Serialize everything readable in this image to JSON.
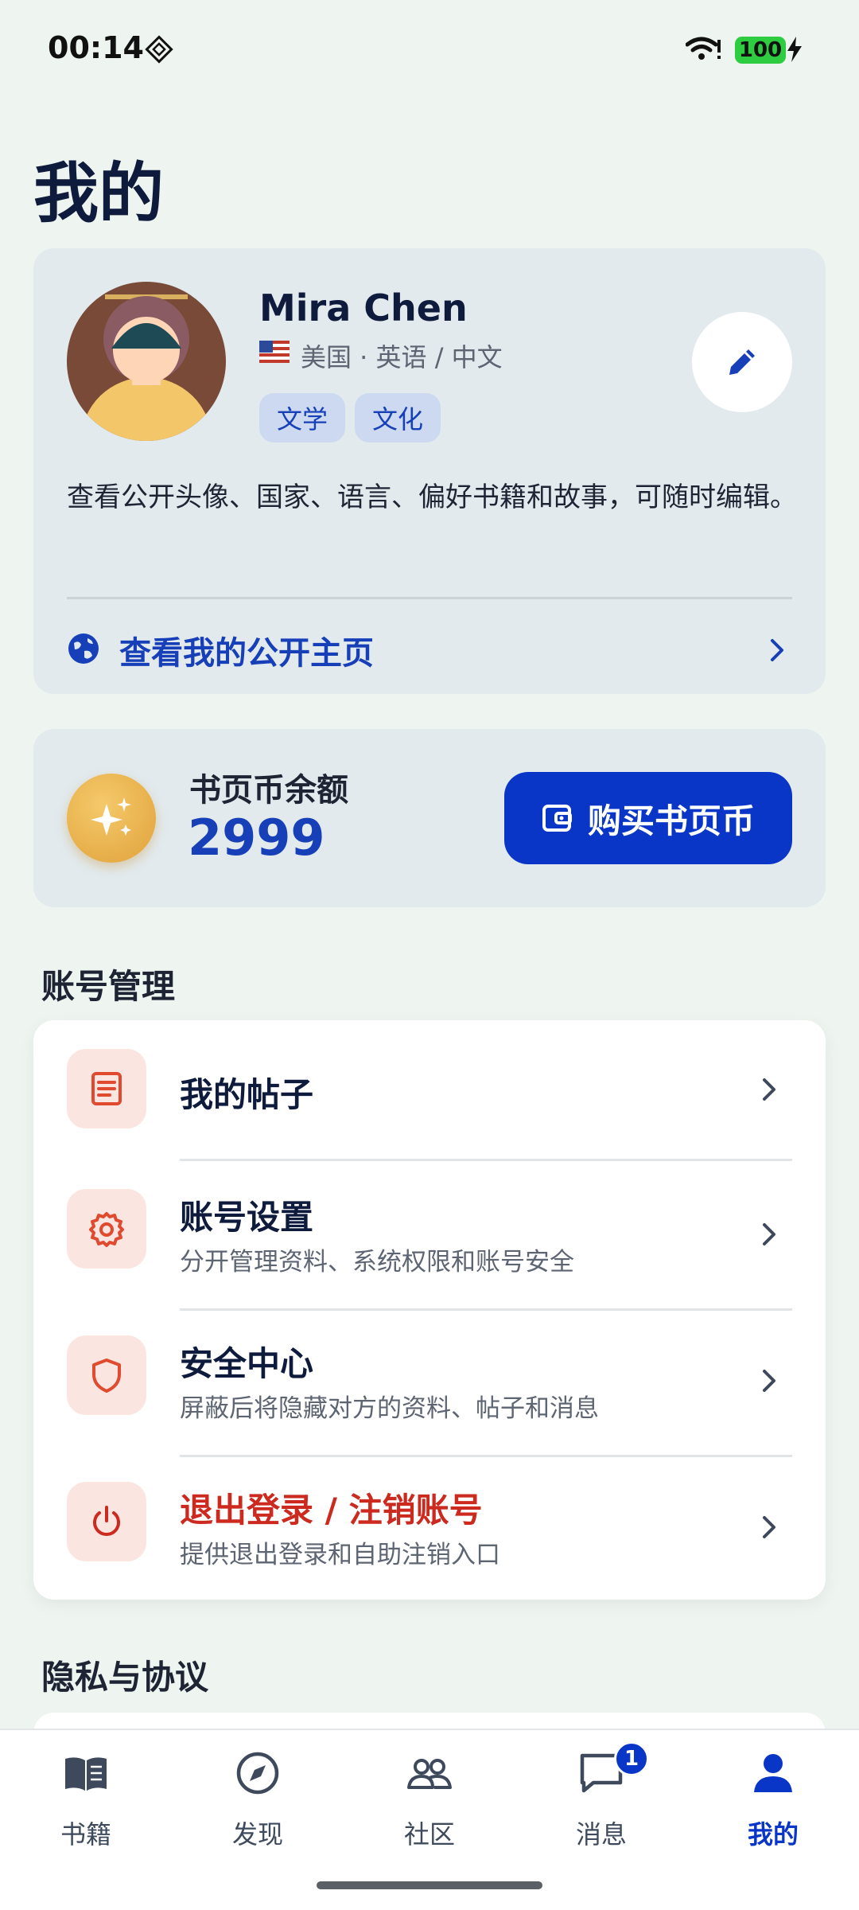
{
  "status_bar": {
    "time": "00:14",
    "battery": "100"
  },
  "page": {
    "title": "我的"
  },
  "profile": {
    "name": "Mira Chen",
    "languages": "美国 · 英语 / 中文",
    "tags": [
      "文学",
      "文化"
    ],
    "description": "查看公开头像、国家、语言、偏好书籍和故事，可随时编辑。",
    "public_link_label": "查看我的公开主页"
  },
  "wallet": {
    "label": "书页币余额",
    "balance": "2999",
    "buy_label": "购买书页币"
  },
  "account_section": {
    "title": "账号管理",
    "items": [
      {
        "title": "我的帖子",
        "subtitle": "",
        "icon": "document-icon"
      },
      {
        "title": "账号设置",
        "subtitle": "分开管理资料、系统权限和账号安全",
        "icon": "gear-icon"
      },
      {
        "title": "安全中心",
        "subtitle": "屏蔽后将隐藏对方的资料、帖子和消息",
        "icon": "shield-icon"
      },
      {
        "title": "退出登录 / 注销账号",
        "subtitle": "提供退出登录和自助注销入口",
        "icon": "power-icon"
      }
    ]
  },
  "privacy_section": {
    "title": "隐私与协议"
  },
  "bottom_nav": {
    "items": [
      {
        "label": "书籍",
        "icon": "book-icon"
      },
      {
        "label": "发现",
        "icon": "compass-icon"
      },
      {
        "label": "社区",
        "icon": "people-icon"
      },
      {
        "label": "消息",
        "icon": "chat-icon",
        "badge": "1"
      },
      {
        "label": "我的",
        "icon": "person-icon",
        "active": true
      }
    ]
  },
  "colors": {
    "accent": "#0a36c8",
    "danger": "#cc2a1e",
    "icon_bg": "#fbe5e1",
    "background": "#eef4ef",
    "card": "#e2eaee"
  }
}
